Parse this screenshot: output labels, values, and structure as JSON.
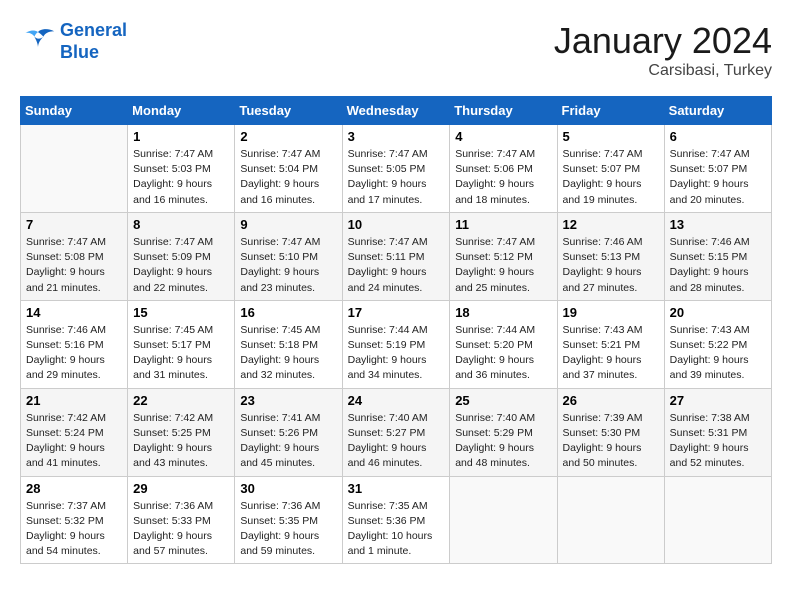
{
  "header": {
    "logo_line1": "General",
    "logo_line2": "Blue",
    "month": "January 2024",
    "location": "Carsibasi, Turkey"
  },
  "columns": [
    "Sunday",
    "Monday",
    "Tuesday",
    "Wednesday",
    "Thursday",
    "Friday",
    "Saturday"
  ],
  "weeks": [
    [
      {
        "day": "",
        "info": ""
      },
      {
        "day": "1",
        "info": "Sunrise: 7:47 AM\nSunset: 5:03 PM\nDaylight: 9 hours\nand 16 minutes."
      },
      {
        "day": "2",
        "info": "Sunrise: 7:47 AM\nSunset: 5:04 PM\nDaylight: 9 hours\nand 16 minutes."
      },
      {
        "day": "3",
        "info": "Sunrise: 7:47 AM\nSunset: 5:05 PM\nDaylight: 9 hours\nand 17 minutes."
      },
      {
        "day": "4",
        "info": "Sunrise: 7:47 AM\nSunset: 5:06 PM\nDaylight: 9 hours\nand 18 minutes."
      },
      {
        "day": "5",
        "info": "Sunrise: 7:47 AM\nSunset: 5:07 PM\nDaylight: 9 hours\nand 19 minutes."
      },
      {
        "day": "6",
        "info": "Sunrise: 7:47 AM\nSunset: 5:07 PM\nDaylight: 9 hours\nand 20 minutes."
      }
    ],
    [
      {
        "day": "7",
        "info": "Sunrise: 7:47 AM\nSunset: 5:08 PM\nDaylight: 9 hours\nand 21 minutes."
      },
      {
        "day": "8",
        "info": "Sunrise: 7:47 AM\nSunset: 5:09 PM\nDaylight: 9 hours\nand 22 minutes."
      },
      {
        "day": "9",
        "info": "Sunrise: 7:47 AM\nSunset: 5:10 PM\nDaylight: 9 hours\nand 23 minutes."
      },
      {
        "day": "10",
        "info": "Sunrise: 7:47 AM\nSunset: 5:11 PM\nDaylight: 9 hours\nand 24 minutes."
      },
      {
        "day": "11",
        "info": "Sunrise: 7:47 AM\nSunset: 5:12 PM\nDaylight: 9 hours\nand 25 minutes."
      },
      {
        "day": "12",
        "info": "Sunrise: 7:46 AM\nSunset: 5:13 PM\nDaylight: 9 hours\nand 27 minutes."
      },
      {
        "day": "13",
        "info": "Sunrise: 7:46 AM\nSunset: 5:15 PM\nDaylight: 9 hours\nand 28 minutes."
      }
    ],
    [
      {
        "day": "14",
        "info": "Sunrise: 7:46 AM\nSunset: 5:16 PM\nDaylight: 9 hours\nand 29 minutes."
      },
      {
        "day": "15",
        "info": "Sunrise: 7:45 AM\nSunset: 5:17 PM\nDaylight: 9 hours\nand 31 minutes."
      },
      {
        "day": "16",
        "info": "Sunrise: 7:45 AM\nSunset: 5:18 PM\nDaylight: 9 hours\nand 32 minutes."
      },
      {
        "day": "17",
        "info": "Sunrise: 7:44 AM\nSunset: 5:19 PM\nDaylight: 9 hours\nand 34 minutes."
      },
      {
        "day": "18",
        "info": "Sunrise: 7:44 AM\nSunset: 5:20 PM\nDaylight: 9 hours\nand 36 minutes."
      },
      {
        "day": "19",
        "info": "Sunrise: 7:43 AM\nSunset: 5:21 PM\nDaylight: 9 hours\nand 37 minutes."
      },
      {
        "day": "20",
        "info": "Sunrise: 7:43 AM\nSunset: 5:22 PM\nDaylight: 9 hours\nand 39 minutes."
      }
    ],
    [
      {
        "day": "21",
        "info": "Sunrise: 7:42 AM\nSunset: 5:24 PM\nDaylight: 9 hours\nand 41 minutes."
      },
      {
        "day": "22",
        "info": "Sunrise: 7:42 AM\nSunset: 5:25 PM\nDaylight: 9 hours\nand 43 minutes."
      },
      {
        "day": "23",
        "info": "Sunrise: 7:41 AM\nSunset: 5:26 PM\nDaylight: 9 hours\nand 45 minutes."
      },
      {
        "day": "24",
        "info": "Sunrise: 7:40 AM\nSunset: 5:27 PM\nDaylight: 9 hours\nand 46 minutes."
      },
      {
        "day": "25",
        "info": "Sunrise: 7:40 AM\nSunset: 5:29 PM\nDaylight: 9 hours\nand 48 minutes."
      },
      {
        "day": "26",
        "info": "Sunrise: 7:39 AM\nSunset: 5:30 PM\nDaylight: 9 hours\nand 50 minutes."
      },
      {
        "day": "27",
        "info": "Sunrise: 7:38 AM\nSunset: 5:31 PM\nDaylight: 9 hours\nand 52 minutes."
      }
    ],
    [
      {
        "day": "28",
        "info": "Sunrise: 7:37 AM\nSunset: 5:32 PM\nDaylight: 9 hours\nand 54 minutes."
      },
      {
        "day": "29",
        "info": "Sunrise: 7:36 AM\nSunset: 5:33 PM\nDaylight: 9 hours\nand 57 minutes."
      },
      {
        "day": "30",
        "info": "Sunrise: 7:36 AM\nSunset: 5:35 PM\nDaylight: 9 hours\nand 59 minutes."
      },
      {
        "day": "31",
        "info": "Sunrise: 7:35 AM\nSunset: 5:36 PM\nDaylight: 10 hours\nand 1 minute."
      },
      {
        "day": "",
        "info": ""
      },
      {
        "day": "",
        "info": ""
      },
      {
        "day": "",
        "info": ""
      }
    ]
  ]
}
